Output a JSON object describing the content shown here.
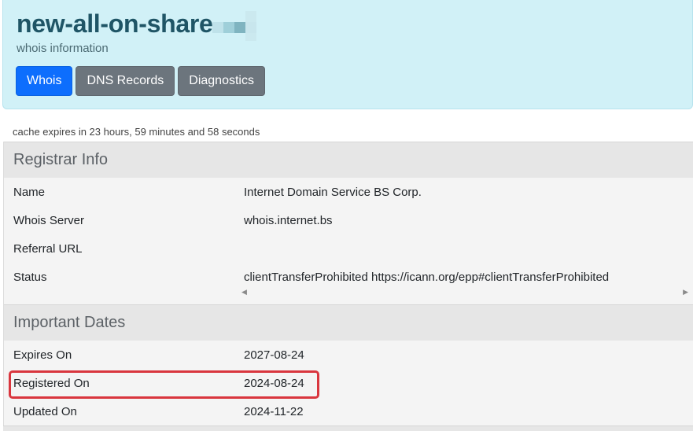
{
  "header": {
    "domain": "new-all-on-share",
    "subtitle": "whois information",
    "tabs": [
      {
        "label": "Whois",
        "active": true
      },
      {
        "label": "DNS Records",
        "active": false
      },
      {
        "label": "Diagnostics",
        "active": false
      }
    ]
  },
  "cache_note": "cache expires in 23 hours, 59 minutes and 58 seconds",
  "registrar": {
    "heading": "Registrar Info",
    "rows": [
      {
        "key": "Name",
        "value": "Internet Domain Service BS Corp."
      },
      {
        "key": "Whois Server",
        "value": "whois.internet.bs"
      },
      {
        "key": "Referral URL",
        "value": ""
      },
      {
        "key": "Status",
        "value": "clientTransferProhibited https://icann.org/epp#clientTransferProhibited"
      }
    ]
  },
  "dates": {
    "heading": "Important Dates",
    "rows": [
      {
        "key": "Expires On",
        "value": "2027-08-24"
      },
      {
        "key": "Registered On",
        "value": "2024-08-24"
      },
      {
        "key": "Updated On",
        "value": "2024-11-22"
      }
    ]
  },
  "icons": {
    "scroll_left": "scroll-left-icon",
    "scroll_right": "scroll-right-icon"
  },
  "colors": {
    "header_bg": "#d1f1f7",
    "title": "#1f5566",
    "tab_active": "#0d6efd",
    "tab_inactive": "#6c757d",
    "highlight": "#d9363e"
  }
}
